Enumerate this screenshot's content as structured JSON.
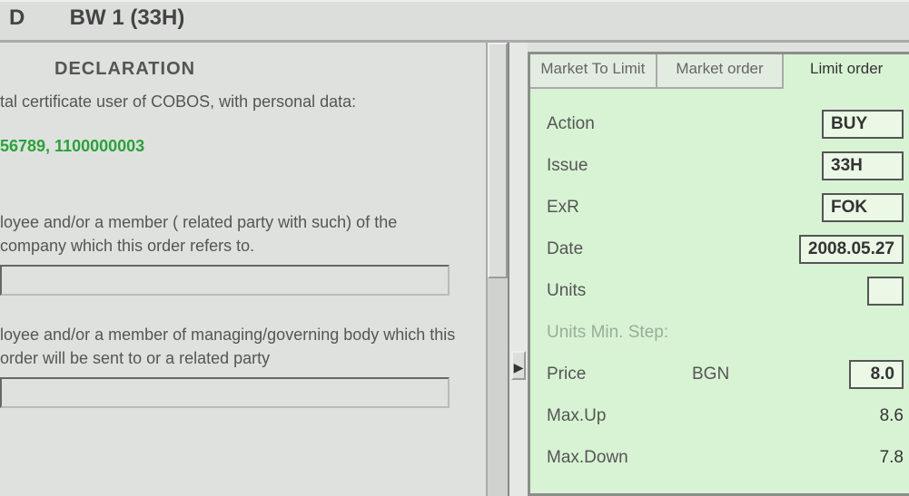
{
  "title": {
    "left": "D",
    "right": "BW 1 (33H)"
  },
  "declaration": {
    "heading": "DECLARATION",
    "line1": "tal certificate user of COBOS, with personal data:",
    "green": "56789, 1100000003",
    "para1": "loyee and/or a member ( related party with such) of the company which this order refers to.",
    "para2": "loyee and/or a member of managing/governing body which this order will be sent to or a related party"
  },
  "tabs": {
    "t0": "Market To Limit",
    "t1": "Market order",
    "t2": "Limit order"
  },
  "order": {
    "action": {
      "label": "Action",
      "value": "BUY"
    },
    "issue": {
      "label": "Issue",
      "value": "33H"
    },
    "exr": {
      "label": "ExR",
      "value": "FOK"
    },
    "date": {
      "label": "Date",
      "value": "2008.05.27"
    },
    "units": {
      "label": "Units",
      "value": ""
    },
    "step": {
      "label": "Units Min. Step:"
    },
    "price": {
      "label": "Price",
      "ccy": "BGN",
      "value": "8.0"
    },
    "maxup": {
      "label": "Max.Up",
      "value": "8.6"
    },
    "maxdn": {
      "label": "Max.Down",
      "value": "7.8"
    }
  }
}
